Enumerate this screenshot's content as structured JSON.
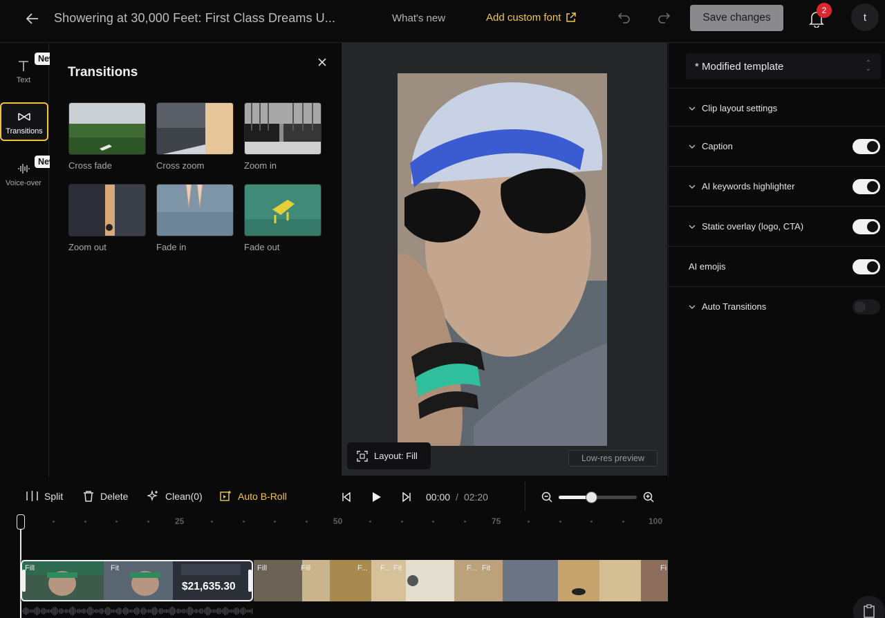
{
  "header": {
    "title": "Showering at 30,000 Feet: First Class Dreams U...",
    "whats_new": "What's new",
    "add_custom_font": "Add custom font",
    "save_changes": "Save changes",
    "notification_count": "2",
    "avatar_initial": "t"
  },
  "rail": {
    "items": [
      {
        "label": "Text",
        "icon": "text-icon",
        "badge": "New"
      },
      {
        "label": "Transitions",
        "icon": "transitions-icon"
      },
      {
        "label": "Voice-over",
        "icon": "waveform-icon",
        "badge": "New"
      }
    ]
  },
  "transitions_panel": {
    "title": "Transitions",
    "items": [
      {
        "label": "Cross fade"
      },
      {
        "label": "Cross zoom"
      },
      {
        "label": "Zoom in"
      },
      {
        "label": "Zoom out"
      },
      {
        "label": "Fade in"
      },
      {
        "label": "Fade out"
      }
    ]
  },
  "preview": {
    "layout_button": "Layout: Fill",
    "lowres": "Low-res preview"
  },
  "settings": {
    "template": "* Modified template",
    "rows": [
      {
        "label": "Clip layout settings",
        "expandable": true
      },
      {
        "label": "Caption",
        "expandable": true,
        "toggle": true
      },
      {
        "label": "AI keywords highlighter",
        "expandable": true,
        "toggle": true
      },
      {
        "label": "Static overlay (logo, CTA)",
        "expandable": true,
        "toggle": true
      },
      {
        "label": "AI emojis",
        "expandable": false,
        "toggle": true
      },
      {
        "label": "Auto Transitions",
        "expandable": true,
        "toggle": false
      }
    ]
  },
  "toolbar": {
    "split": "Split",
    "delete": "Delete",
    "clean": "Clean(0)",
    "auto_broll": "Auto B-Roll",
    "current_time": "00:00",
    "separator": "/",
    "total_time": "02:20",
    "zoom_level": 0.42
  },
  "timeline": {
    "ruler_labels": [
      "25",
      "50",
      "75",
      "100"
    ],
    "clip_labels": [
      "Fill",
      "Fit",
      "Fill",
      "Fill",
      "F...",
      "F...",
      "Fit",
      "F...",
      "Fit",
      "Fi"
    ],
    "price_text": "$21,635.30"
  },
  "colors": {
    "accent_yellow": "#f3c64f",
    "badge_red": "#d9262f"
  }
}
